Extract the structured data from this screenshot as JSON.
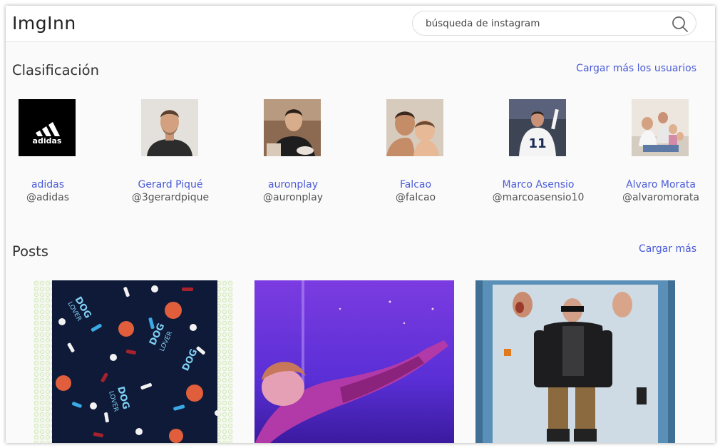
{
  "header": {
    "logo": "ImgInn",
    "search_placeholder": "búsqueda de instagram"
  },
  "ranking": {
    "title": "Clasificación",
    "more_link": "Cargar más los usuarios",
    "users": [
      {
        "name": "adidas",
        "handle": "@adidas",
        "avatar_icon": "adidas-logo"
      },
      {
        "name": "Gerard Piqué",
        "handle": "@3gerardpique",
        "avatar_icon": "man-portrait-photo"
      },
      {
        "name": "auronplay",
        "handle": "@auronplay",
        "avatar_icon": "man-seated-photo"
      },
      {
        "name": "Falcao",
        "handle": "@falcao",
        "avatar_icon": "man-with-baby-photo"
      },
      {
        "name": "Marco Asensio",
        "handle": "@marcoasensio10",
        "avatar_icon": "football-player-photo"
      },
      {
        "name": "Álvaro Morata",
        "handle": "@alvaromorata",
        "avatar_icon": "family-photo"
      }
    ]
  },
  "posts": {
    "title": "Posts",
    "more_link": "Cargar más",
    "items": [
      {
        "image": "dog-lover-fabric-photo",
        "print_text": "DOG LOVER"
      },
      {
        "image": "stage-performer-photo"
      },
      {
        "image": "action-figure-photo"
      }
    ]
  },
  "colors": {
    "link": "#4a5bd6",
    "background": "#fafafa",
    "header": "#ffffff"
  }
}
